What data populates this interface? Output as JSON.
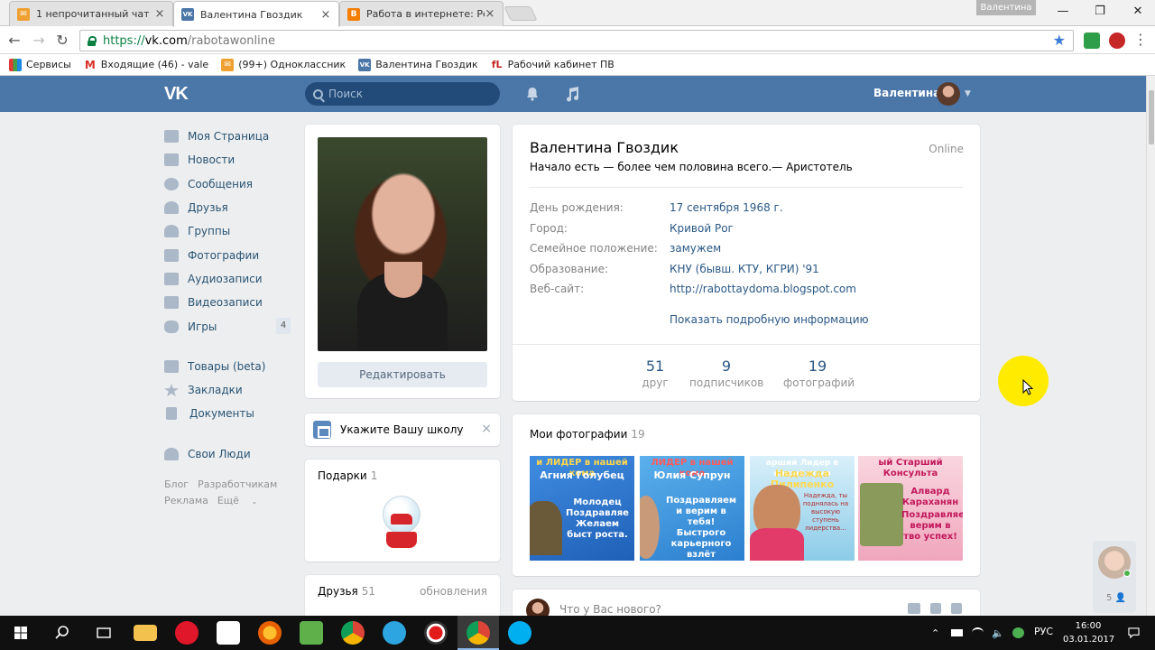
{
  "browser": {
    "tabs": [
      {
        "title": "1 непрочитанный чат",
        "favicon_color": "#f0a030",
        "favicon_glyph": "✉"
      },
      {
        "title": "Валентина Гвоздик",
        "favicon_color": "#4a76a8",
        "favicon_glyph": "VK"
      },
      {
        "title": "Работа в интернете: Ре",
        "favicon_color": "#f57d00",
        "favicon_glyph": "B"
      }
    ],
    "user_chip": "Валентина",
    "url": {
      "scheme": "https://",
      "host": "vk.com",
      "path": "/rabotawonline"
    },
    "bookmarks": [
      {
        "label": "Сервисы",
        "color": "#e0e0e0",
        "glyph": "⋮⋮"
      },
      {
        "label": "Входящие (46) - vale",
        "color": "#d93025",
        "glyph": "M"
      },
      {
        "label": "(99+) Одноклассник",
        "color": "#f0a030",
        "glyph": "✉"
      },
      {
        "label": "Валентина Гвоздик",
        "color": "#4a76a8",
        "glyph": "VK"
      },
      {
        "label": "Рабочий кабинет ПВ",
        "color": "#c62828",
        "glyph": "fL"
      }
    ]
  },
  "vk": {
    "logo": "VK",
    "search_placeholder": "Поиск",
    "user_name": "Валентина",
    "menu": [
      {
        "label": "Моя Страница",
        "badge": ""
      },
      {
        "label": "Новости",
        "badge": ""
      },
      {
        "label": "Сообщения",
        "badge": ""
      },
      {
        "label": "Друзья",
        "badge": ""
      },
      {
        "label": "Группы",
        "badge": ""
      },
      {
        "label": "Фотографии",
        "badge": ""
      },
      {
        "label": "Аудиозаписи",
        "badge": ""
      },
      {
        "label": "Видеозаписи",
        "badge": ""
      },
      {
        "label": "Игры",
        "badge": "4"
      }
    ],
    "menu2": [
      {
        "label": "Товары (beta)"
      },
      {
        "label": "Закладки"
      },
      {
        "label": "Документы"
      }
    ],
    "menu3": [
      {
        "label": "Свои Люди"
      }
    ],
    "footer": {
      "blog": "Блог",
      "developers": "Разработчикам",
      "ads": "Реклама",
      "more": "Ещё"
    },
    "edit_button": "Редактировать",
    "school_prompt": "Укажите Вашу школу",
    "gifts": {
      "title": "Подарки",
      "count": "1"
    },
    "friends": {
      "title": "Друзья",
      "count": "51",
      "updates": "обновления"
    },
    "profile": {
      "name": "Валентина Гвоздик",
      "online": "Online",
      "status": "Начало есть — более чем половина всего.— Аристотель",
      "info": [
        {
          "label": "День рождения:",
          "value": "17 сентября 1968 г."
        },
        {
          "label": "Город:",
          "value": "Кривой Рог"
        },
        {
          "label": "Семейное положение:",
          "value": "замужем"
        },
        {
          "label": "Образование:",
          "value": "КНУ (бывш. КТУ, КГРИ) '91"
        },
        {
          "label": "Веб-сайт:",
          "value": "http://rabottaydoma.blogspot.com"
        }
      ],
      "show_more": "Показать подробную информацию",
      "stats": [
        {
          "num": "51",
          "label": "друг"
        },
        {
          "num": "9",
          "label": "подписчиков"
        },
        {
          "num": "19",
          "label": "фотографий"
        }
      ]
    },
    "photos": {
      "title": "Мои фотографии",
      "count": "19",
      "items": [
        {
          "top": "и ЛИДЕР в нашей кома",
          "name": "Агния Голубец",
          "text": "Молодец Поздравляе Желаем быст роста.",
          "bg": "#2e6fcf"
        },
        {
          "top": "ЛИДЕР в нашей кома",
          "name": "Юлия Супрун",
          "text": "Поздравляем и верим в тебя! Быстрого карьерного взлёт",
          "bg": "#3b8fd9"
        },
        {
          "top": "арший Лидер в нашей комо",
          "name": "Надежда Пилипенко",
          "text": "Надежда, ты поднялась на высокую ступень лидерства...",
          "bg": "#7fc5e6"
        },
        {
          "top": "ый Старший Консульта",
          "name": "Алвард Караханян",
          "text": "Поздравляем верим в тво успех!",
          "bg": "#f2b6c8"
        }
      ]
    },
    "post_placeholder": "Что у Вас нового?",
    "float_chat_count": "5"
  },
  "taskbar": {
    "lang": "РУС",
    "time": "16:00",
    "date": "03.01.2017"
  }
}
